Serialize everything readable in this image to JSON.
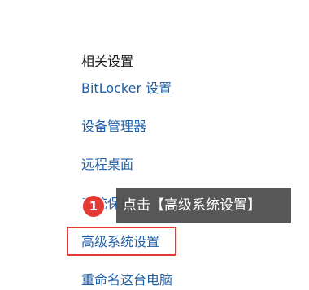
{
  "section": {
    "title": "相关设置"
  },
  "links": {
    "bitlocker": "BitLocker 设置",
    "device_manager": "设备管理器",
    "remote_desktop": "远程桌面",
    "system_protection": "系统保护",
    "advanced_settings": "高级系统设置",
    "rename_pc": "重命名这台电脑"
  },
  "annotation": {
    "step_number": "1",
    "tooltip_text": "点击【高级系统设置】",
    "highlight_color": "#e53935",
    "tooltip_color": "#4a4a4a"
  },
  "colors": {
    "link": "#1f5fa8",
    "text": "#1a1a1a",
    "background": "#ffffff"
  }
}
